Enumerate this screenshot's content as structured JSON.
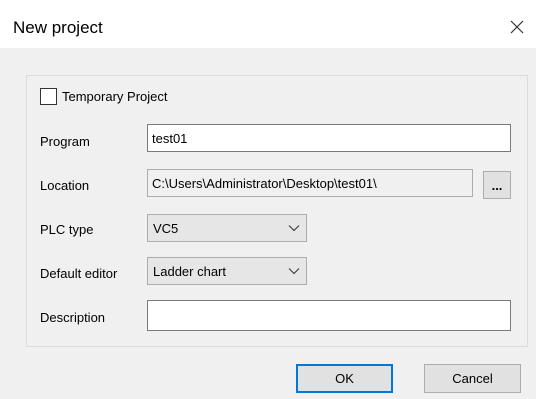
{
  "dialog": {
    "title": "New project"
  },
  "form": {
    "temporary_project": {
      "label": "Temporary Project",
      "checked": false
    },
    "program": {
      "label": "Program",
      "value": "test01"
    },
    "location": {
      "label": "Location",
      "value": "C:\\Users\\Administrator\\Desktop\\test01\\",
      "browse_label": "..."
    },
    "plc_type": {
      "label": "PLC type",
      "selected": "VC5"
    },
    "default_editor": {
      "label": "Default editor",
      "selected": "Ladder chart"
    },
    "description": {
      "label": "Description",
      "value": ""
    }
  },
  "buttons": {
    "ok_label": "OK",
    "cancel_label": "Cancel"
  },
  "colors": {
    "content_bg": "#f0f0f0",
    "focus_border": "#0078d7"
  },
  "icons": {
    "close": "close-icon",
    "dropdown": "chevron-down-icon"
  }
}
